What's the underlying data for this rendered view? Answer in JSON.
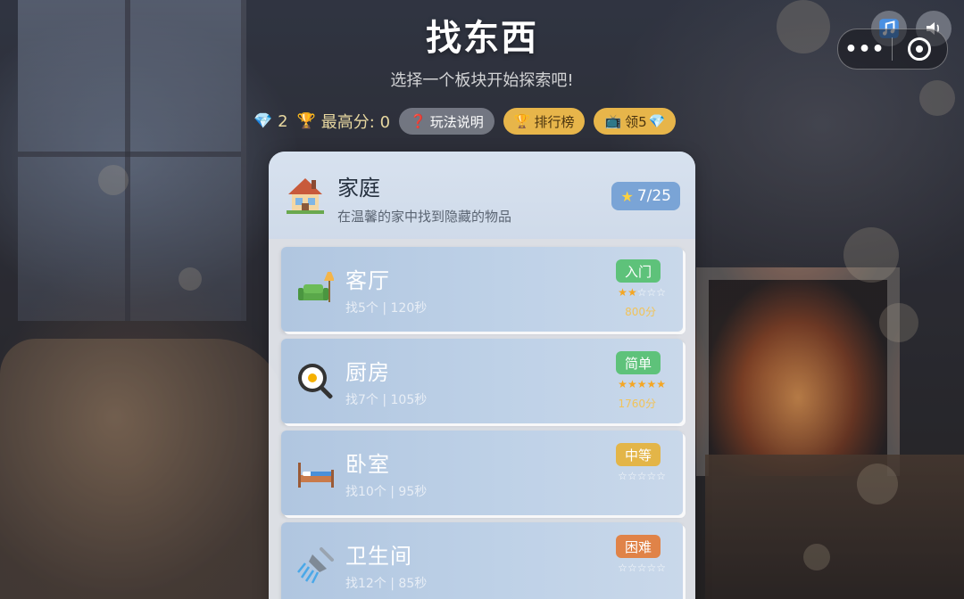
{
  "header": {
    "title": "找东西",
    "subtitle": "选择一个板块开始探索吧!"
  },
  "top_controls": {
    "music_icon": "music-note-icon",
    "sound_icon": "speaker-icon",
    "more_label": "•••",
    "close_icon": "target-circle-icon"
  },
  "stats": {
    "gems": "2",
    "best_score_label": "最高分: 0",
    "help_label": "玩法说明",
    "leaderboard_label": "排行榜",
    "claim_label": "领5"
  },
  "category": {
    "title": "家庭",
    "description": "在温馨的家中找到隐藏的物品",
    "progress": "7/25"
  },
  "levels": [
    {
      "name": "客厅",
      "meta": "找5个 | 120秒",
      "difficulty": "入门",
      "stars_earned": 2,
      "stars_total": 5,
      "score": "800分",
      "icon": "sofa-lamp-icon"
    },
    {
      "name": "厨房",
      "meta": "找7个 | 105秒",
      "difficulty": "简单",
      "stars_earned": 5,
      "stars_total": 5,
      "score": "1760分",
      "icon": "frying-pan-icon"
    },
    {
      "name": "卧室",
      "meta": "找10个 | 95秒",
      "difficulty": "中等",
      "stars_earned": 0,
      "stars_total": 5,
      "score": "",
      "icon": "bed-icon"
    },
    {
      "name": "卫生间",
      "meta": "找12个 | 85秒",
      "difficulty": "困难",
      "stars_earned": 0,
      "stars_total": 5,
      "score": "",
      "icon": "shower-icon"
    }
  ],
  "colors": {
    "accent_gold": "#e7b54a",
    "diff_entry": "#5ec27a",
    "diff_easy": "#5ec27a",
    "diff_medium": "#e3b548",
    "diff_hard": "#e08348",
    "progress_badge": "#7aa4d6"
  }
}
